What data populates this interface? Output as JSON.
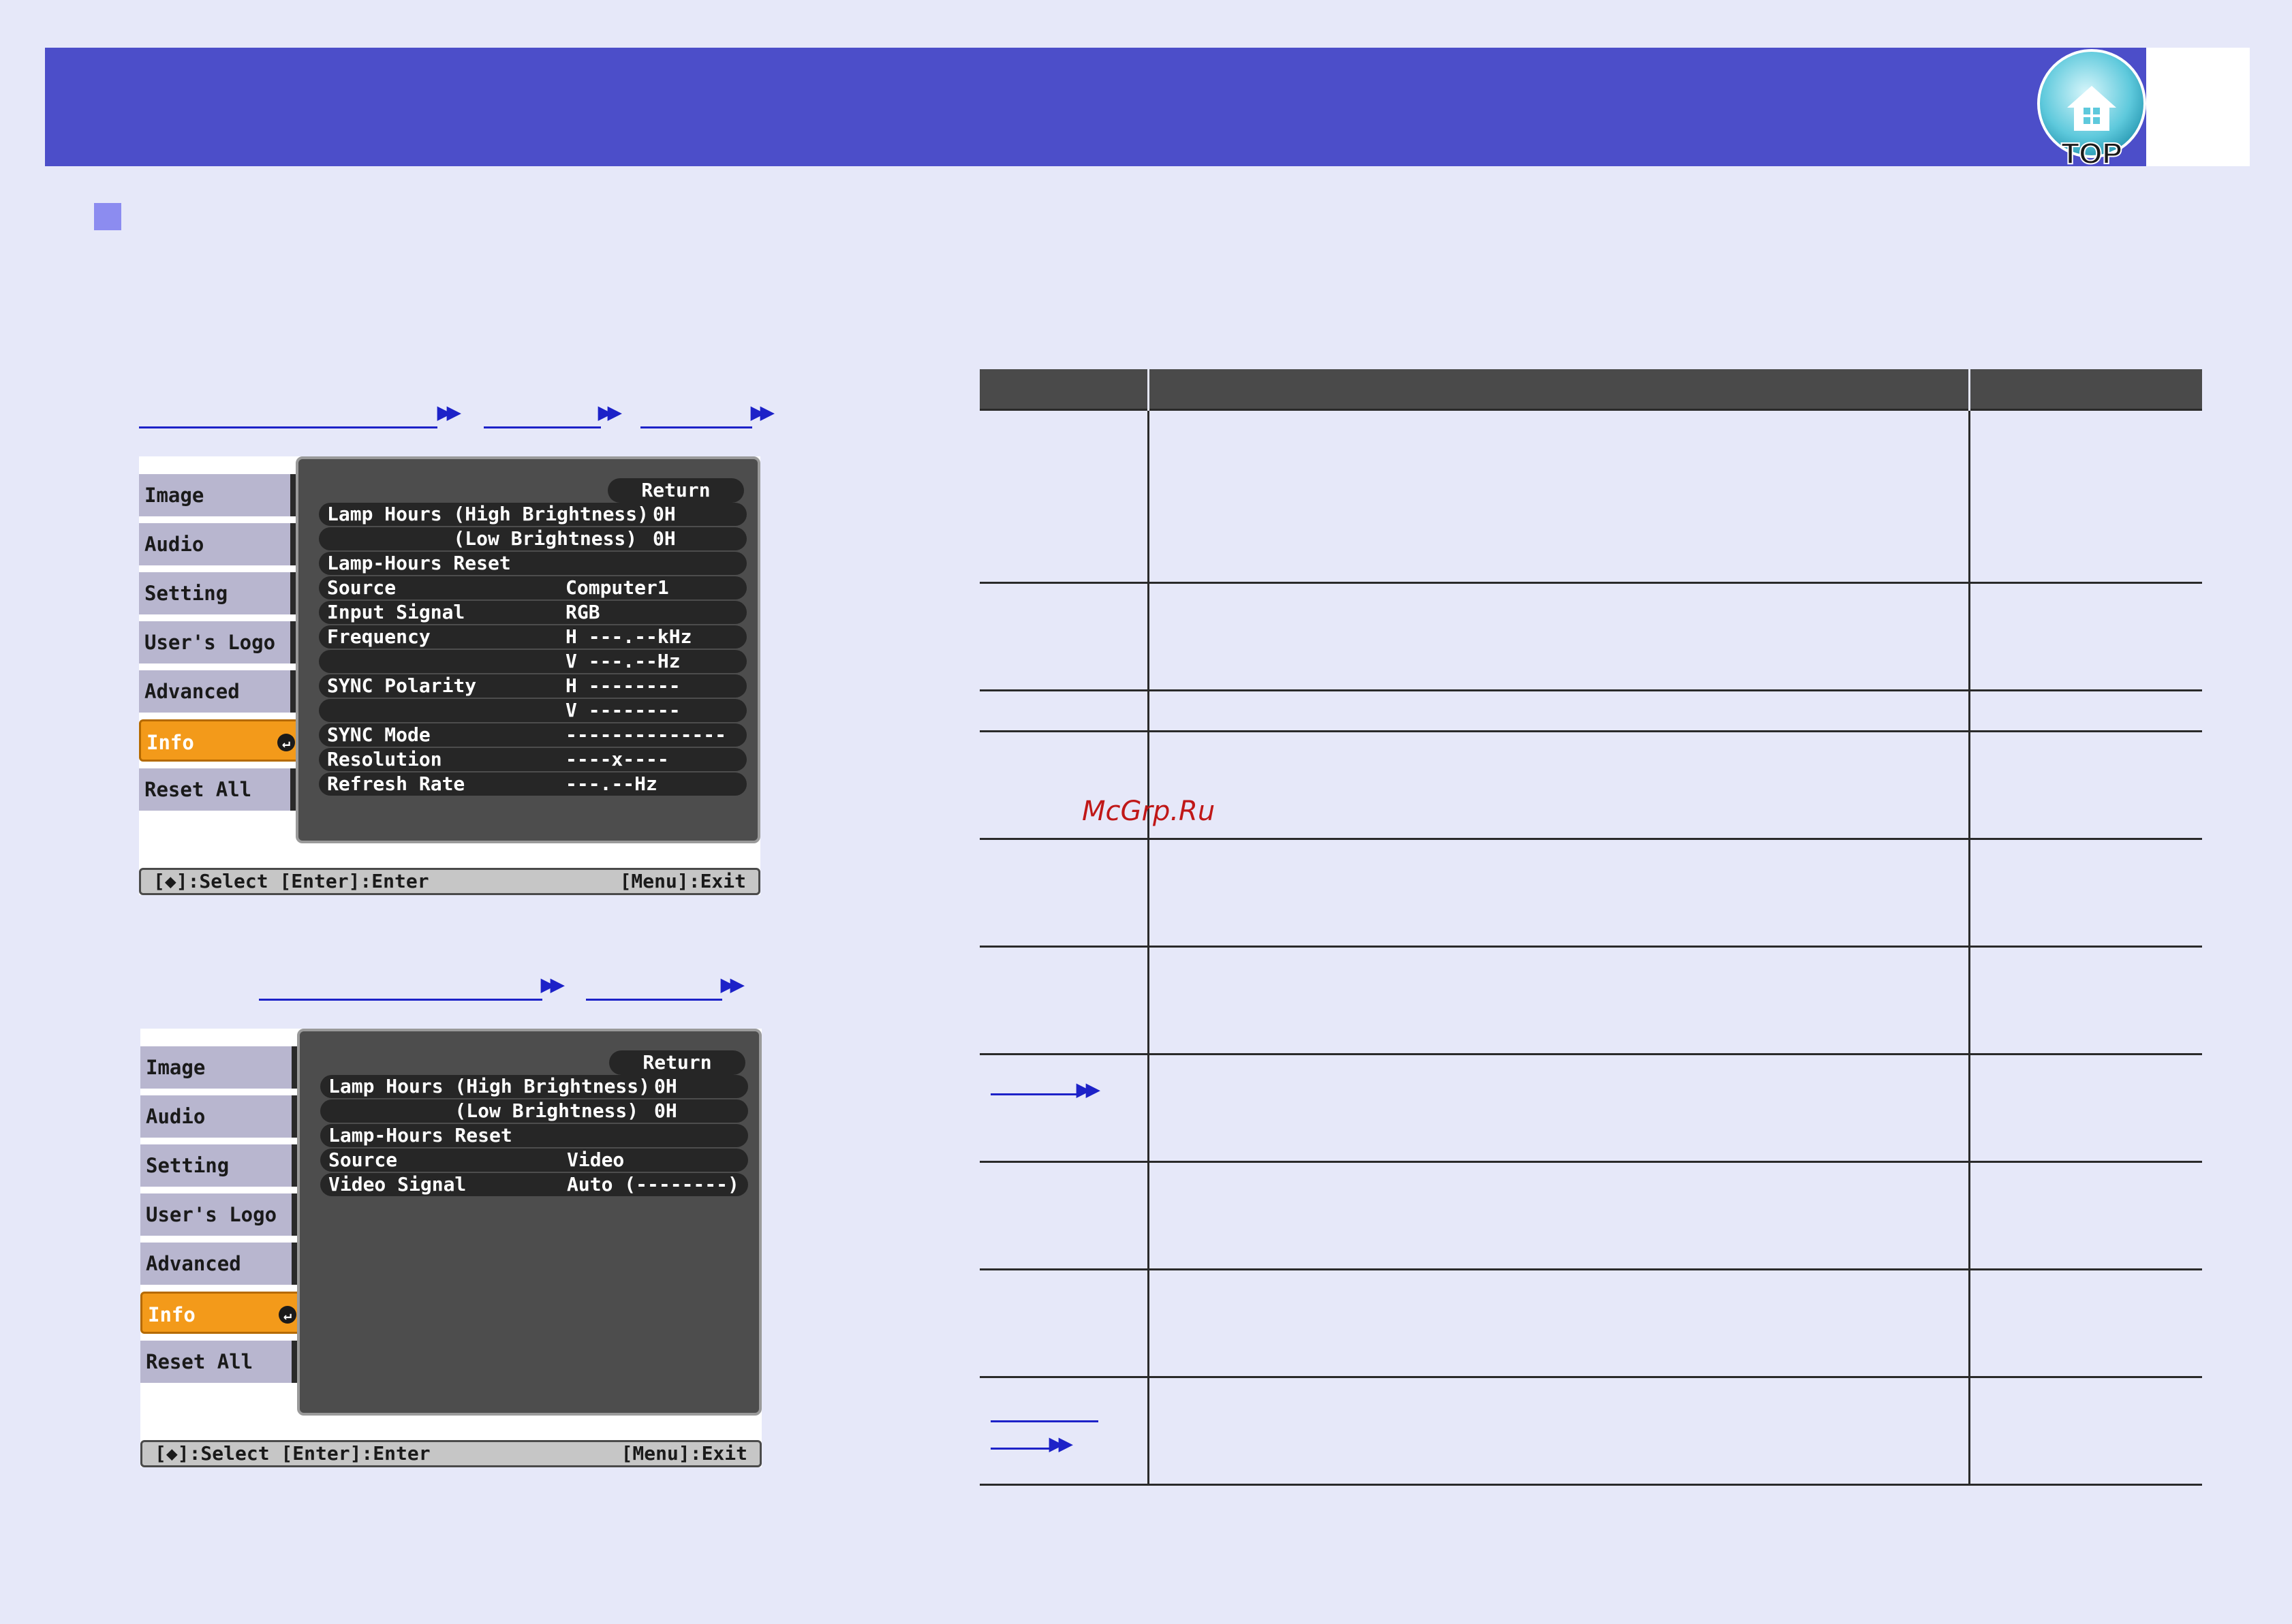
{
  "header": {
    "logo_text": "TOP",
    "logo_icon": "home-icon"
  },
  "menu_computer": {
    "tabs": [
      "Image",
      "Audio",
      "Setting",
      "User's Logo",
      "Advanced",
      "Info",
      "Reset All"
    ],
    "active_tab": "Info",
    "return_label": "Return",
    "rows": [
      {
        "label": "Lamp Hours (High Brightness)",
        "value": "0H"
      },
      {
        "label": "           (Low Brightness)",
        "value": "0H"
      },
      {
        "label": "Lamp-Hours Reset",
        "value": ""
      },
      {
        "label": "Source",
        "value": "Computer1"
      },
      {
        "label": "Input Signal",
        "value": "RGB"
      },
      {
        "label": "Frequency",
        "value": "H ---.--kHz"
      },
      {
        "label": "",
        "value": "V ---.--Hz"
      },
      {
        "label": "SYNC Polarity",
        "value": "H --------"
      },
      {
        "label": "",
        "value": "V --------"
      },
      {
        "label": "SYNC Mode",
        "value": "--------------"
      },
      {
        "label": "Resolution",
        "value": "----x----"
      },
      {
        "label": "Refresh Rate",
        "value": "---.--Hz"
      }
    ],
    "footer_left": "[◆]:Select [Enter]:Enter",
    "footer_right": "[Menu]:Exit"
  },
  "menu_video": {
    "tabs": [
      "Image",
      "Audio",
      "Setting",
      "User's Logo",
      "Advanced",
      "Info",
      "Reset All"
    ],
    "active_tab": "Info",
    "return_label": "Return",
    "rows": [
      {
        "label": "Lamp Hours (High Brightness)",
        "value": "0H"
      },
      {
        "label": "           (Low Brightness)",
        "value": "0H"
      },
      {
        "label": "Lamp-Hours Reset",
        "value": ""
      },
      {
        "label": "Source",
        "value": "Video"
      },
      {
        "label": "Video Signal",
        "value": "Auto (--------)"
      }
    ],
    "footer_left": "[◆]:Select [Enter]:Enter",
    "footer_right": "[Menu]:Exit"
  },
  "watermark": "McGrp.Ru"
}
